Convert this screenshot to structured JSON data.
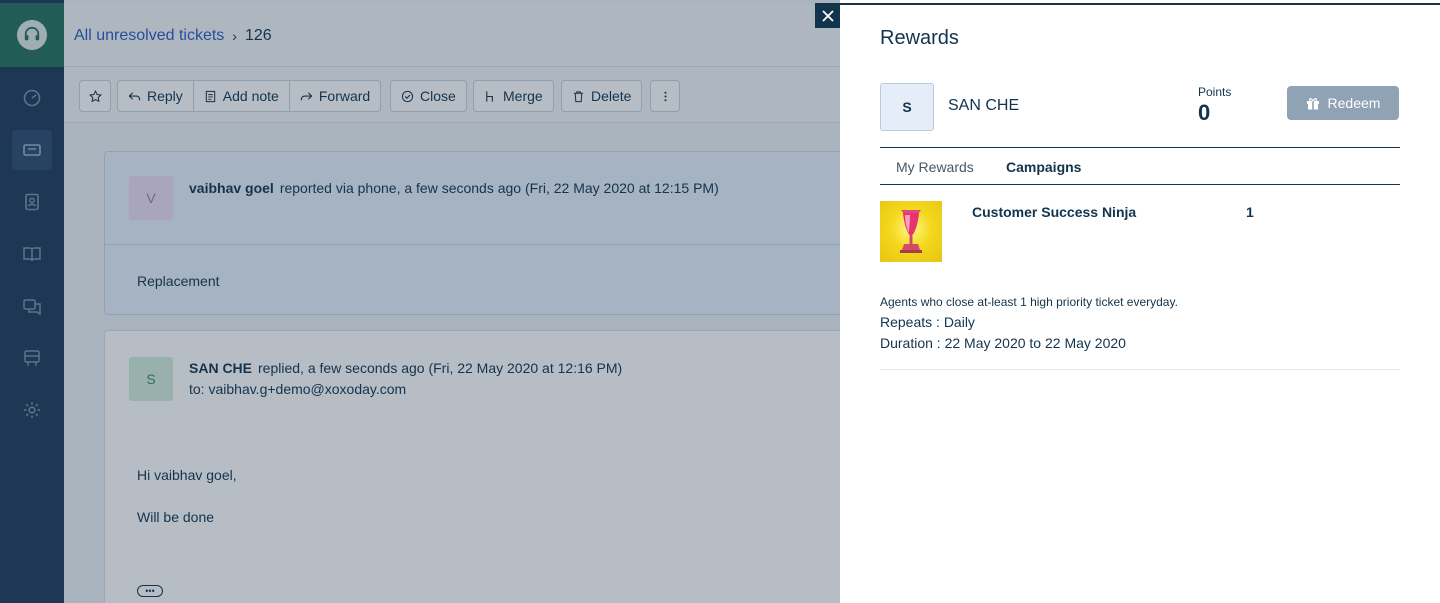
{
  "breadcrumb": {
    "parent": "All unresolved tickets",
    "separator": "›",
    "ticket_id": "126"
  },
  "toolbar": {
    "reply": "Reply",
    "add_note": "Add note",
    "forward": "Forward",
    "close": "Close",
    "merge": "Merge",
    "delete": "Delete"
  },
  "conversation": {
    "first": {
      "avatar_initial": "V",
      "author": "vaibhav goel",
      "meta": "reported via phone, a few seconds ago (Fri, 22 May 2020 at 12:15 PM)",
      "subject": "Replacement"
    },
    "reply": {
      "avatar_initial": "S",
      "author": "SAN CHE",
      "meta": "replied, a few seconds ago (Fri, 22 May 2020 at 12:16 PM)",
      "to_label": "to:",
      "to_address": "vaibhav.g+demo@xoxoday.com",
      "greeting": "Hi vaibhav goel,",
      "body": "Will be done",
      "more": "•••"
    }
  },
  "rewards": {
    "title": "Rewards",
    "user_initial": "S",
    "user_name": "SAN CHE",
    "points_label": "Points",
    "points_value": "0",
    "redeem_label": "Redeem",
    "tabs": [
      "My Rewards",
      "Campaigns"
    ],
    "active_tab": "Campaigns",
    "campaign": {
      "name": "Customer Success Ninja",
      "count": "1",
      "description": "Agents who close at-least 1 high priority ticket everyday.",
      "repeats": "Repeats : Daily",
      "duration": "Duration : 22 May 2020 to 22 May 2020"
    }
  },
  "colors": {
    "sidebar": "#1f3a5b",
    "logo_bg": "#24715e",
    "link": "#2c5cc5",
    "text": "#12344d",
    "redeem_bg": "#8fa3b4"
  },
  "icons": {
    "nav": [
      "dashboard-icon",
      "tickets-icon",
      "contacts-icon",
      "solutions-icon",
      "forums-icon",
      "analytics-icon",
      "admin-gear-icon"
    ],
    "toolbar": [
      "star-icon",
      "reply-icon",
      "note-icon",
      "forward-icon",
      "close-check-icon",
      "merge-icon",
      "trash-icon",
      "more-vertical-icon"
    ]
  }
}
